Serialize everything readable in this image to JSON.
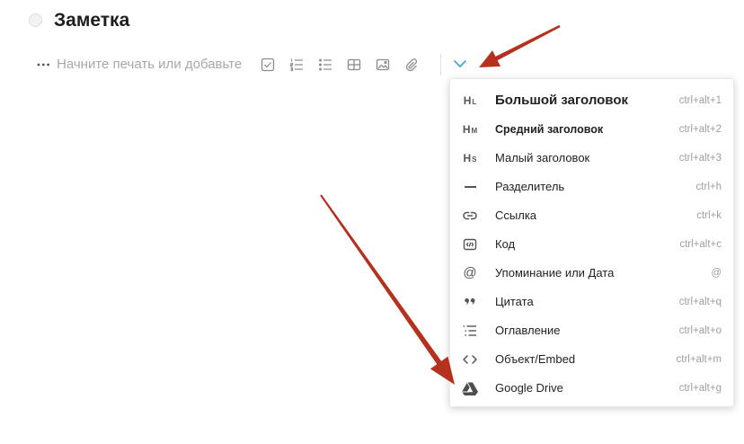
{
  "note": {
    "title": "Заметка",
    "body_placeholder": "Начните печать или добавьте"
  },
  "toolbar": {
    "icons": [
      "more-icon",
      "checkbox-icon",
      "numbered-list-icon",
      "bulleted-list-icon",
      "table-icon",
      "image-icon",
      "paperclip-icon",
      "chevron-down-icon"
    ]
  },
  "menu": {
    "items": [
      {
        "icon": "large-heading-icon",
        "icon_letter": "H",
        "icon_sub": "L",
        "label": "Большой заголовок",
        "shortcut": "ctrl+alt+1"
      },
      {
        "icon": "medium-heading-icon",
        "icon_letter": "H",
        "icon_sub": "M",
        "label": "Средний заголовок",
        "shortcut": "ctrl+alt+2"
      },
      {
        "icon": "small-heading-icon",
        "icon_letter": "H",
        "icon_sub": "S",
        "label": "Малый заголовок",
        "shortcut": "ctrl+alt+3"
      },
      {
        "icon": "divider-icon",
        "label": "Разделитель",
        "shortcut": "ctrl+h"
      },
      {
        "icon": "link-icon",
        "label": "Ссылка",
        "shortcut": "ctrl+k"
      },
      {
        "icon": "code-icon",
        "label": "Код",
        "shortcut": "ctrl+alt+c"
      },
      {
        "icon": "at-sign-icon",
        "icon_glyph": "@",
        "label": "Упоминание или Дата",
        "shortcut": "@"
      },
      {
        "icon": "quote-icon",
        "label": "Цитата",
        "shortcut": "ctrl+alt+q"
      },
      {
        "icon": "table-of-contents-icon",
        "label": "Оглавление",
        "shortcut": "ctrl+alt+o"
      },
      {
        "icon": "embed-icon",
        "label": "Объект/Embed",
        "shortcut": "ctrl+alt+m"
      },
      {
        "icon": "google-drive-icon",
        "label": "Google Drive",
        "shortcut": "ctrl+alt+g"
      }
    ]
  },
  "colors": {
    "accent": "#3d9fd6",
    "icon_gray": "#8c8c8c",
    "annotation_arrow": "#b5311e"
  }
}
